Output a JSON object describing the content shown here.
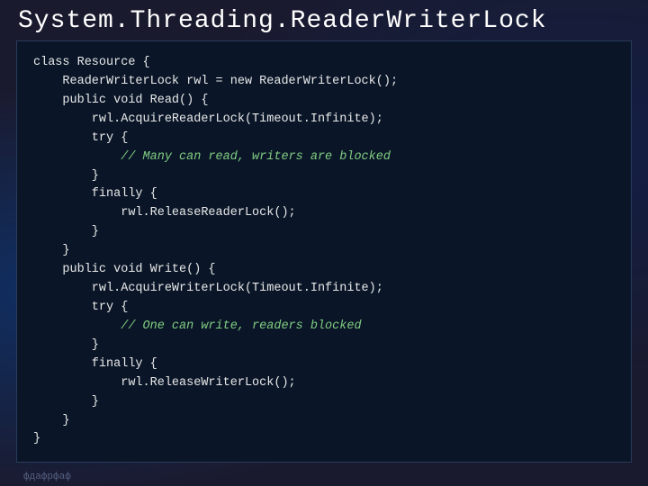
{
  "title": "System.Threading.ReaderWriterLock",
  "code": {
    "lines": [
      {
        "text": "class Resource {",
        "type": "normal"
      },
      {
        "text": "    ReaderWriterLock rwl = new ReaderWriterLock();",
        "type": "normal"
      },
      {
        "text": "    public void Read() {",
        "type": "normal"
      },
      {
        "text": "        rwl.AcquireReaderLock(Timeout.Infinite);",
        "type": "normal"
      },
      {
        "text": "        try {",
        "type": "normal"
      },
      {
        "text": "            // Many can read, writers are blocked",
        "type": "comment"
      },
      {
        "text": "        }",
        "type": "normal"
      },
      {
        "text": "        finally {",
        "type": "normal"
      },
      {
        "text": "            rwl.ReleaseReaderLock();",
        "type": "normal"
      },
      {
        "text": "        }",
        "type": "normal"
      },
      {
        "text": "    }",
        "type": "normal"
      },
      {
        "text": "    public void Write() {",
        "type": "normal"
      },
      {
        "text": "        rwl.AcquireWriterLock(Timeout.Infinite);",
        "type": "normal"
      },
      {
        "text": "        try {",
        "type": "normal"
      },
      {
        "text": "            // One can write, readers blocked",
        "type": "comment"
      },
      {
        "text": "        }",
        "type": "normal"
      },
      {
        "text": "        finally {",
        "type": "normal"
      },
      {
        "text": "            rwl.ReleaseWriterLock();",
        "type": "normal"
      },
      {
        "text": "        }",
        "type": "normal"
      },
      {
        "text": "    }",
        "type": "normal"
      },
      {
        "text": "}",
        "type": "normal"
      }
    ]
  },
  "watermark": "фдафрфаф"
}
